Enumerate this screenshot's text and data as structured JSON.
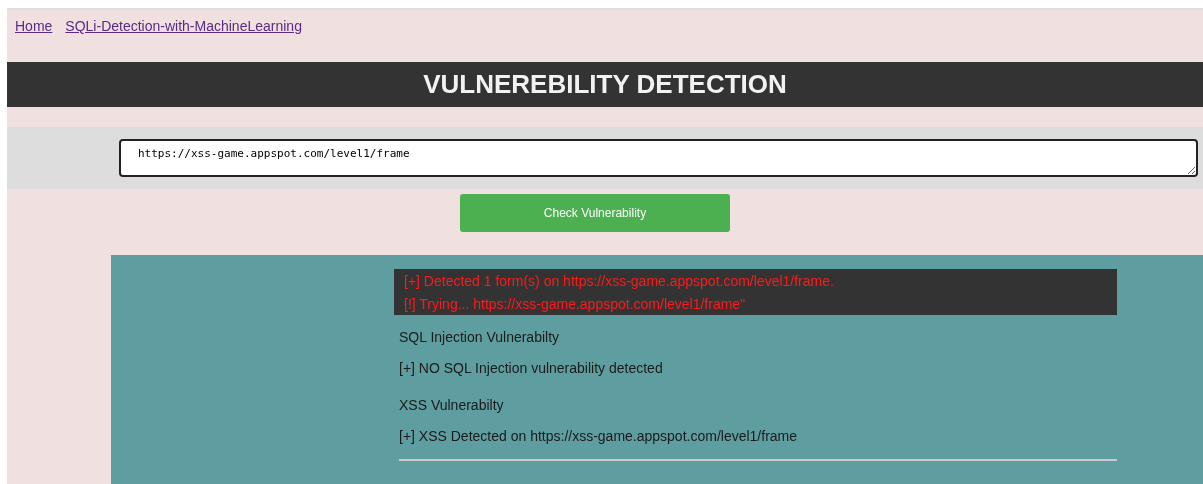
{
  "nav": {
    "links": [
      "Home",
      "SQLi-Detection-with-MachineLearning"
    ]
  },
  "header": {
    "title": "VULNEREBILITY DETECTION"
  },
  "form": {
    "url_value": "https://xss-game.appspot.com/level1/frame",
    "button": "Check Vulnerability"
  },
  "results": {
    "log": [
      "[+] Detected 1 form(s) on https://xss-game.appspot.com/level1/frame.",
      "[!] Trying... https://xss-game.appspot.com/level1/frame\""
    ],
    "sections": [
      {
        "heading": "SQL Injection Vulnerabilty",
        "message": "[+] NO SQL Injection vulnerability detected"
      },
      {
        "heading": "XSS Vulnerabilty",
        "message": "[+] XSS Detected on https://xss-game.appspot.com/level1/frame"
      }
    ]
  }
}
